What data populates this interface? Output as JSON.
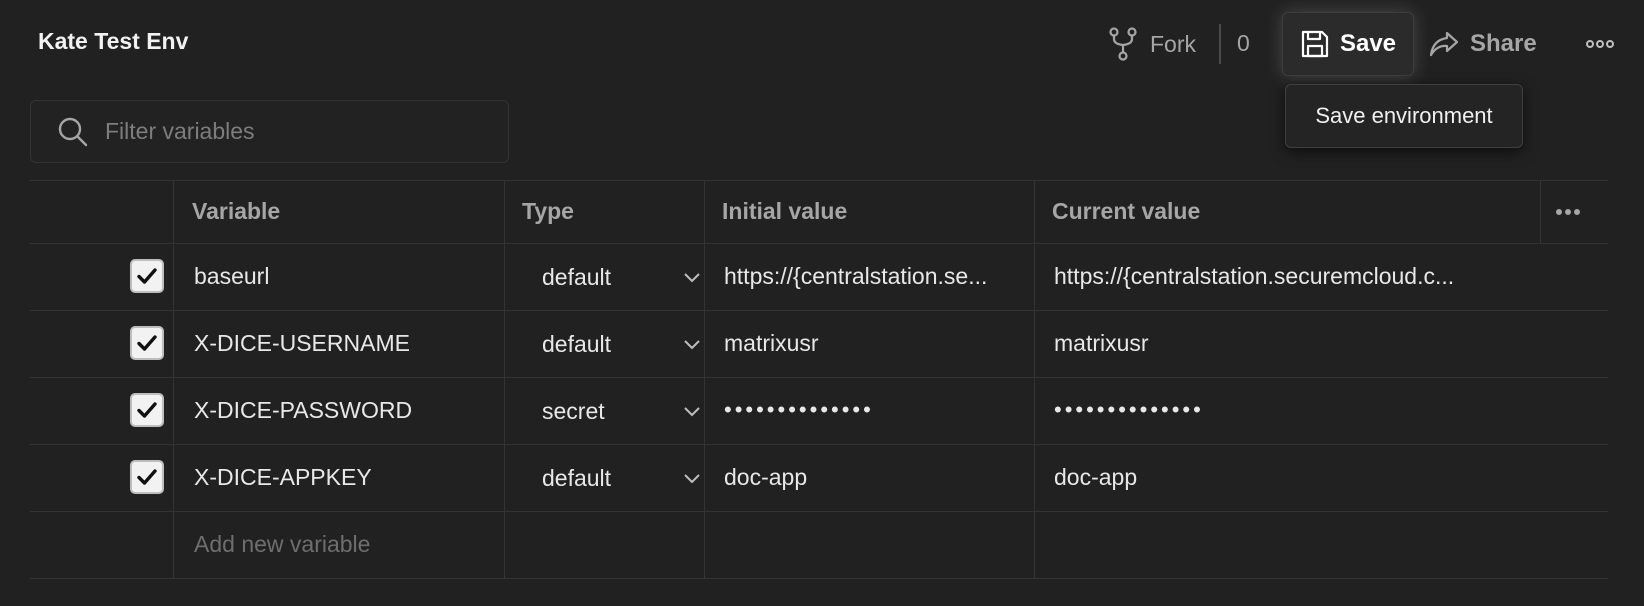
{
  "header": {
    "title": "Kate Test Env",
    "fork_label": "Fork",
    "fork_count": "0",
    "save_label": "Save",
    "share_label": "Share",
    "save_tooltip": "Save environment"
  },
  "filter": {
    "placeholder": "Filter variables",
    "value": ""
  },
  "table": {
    "columns": {
      "variable": "Variable",
      "type": "Type",
      "initial_value": "Initial value",
      "current_value": "Current value"
    },
    "rows": [
      {
        "checked": true,
        "name": "baseurl",
        "type": "default",
        "initial": "https://{centralstation.se...",
        "current": "https://{centralstation.securemcloud.c..."
      },
      {
        "checked": true,
        "name": "X-DICE-USERNAME",
        "type": "default",
        "initial": "matrixusr",
        "current": "matrixusr"
      },
      {
        "checked": true,
        "name": "X-DICE-PASSWORD",
        "type": "secret",
        "initial": "••••••••••••••",
        "current": "••••••••••••••"
      },
      {
        "checked": true,
        "name": "X-DICE-APPKEY",
        "type": "default",
        "initial": "doc-app",
        "current": "doc-app"
      }
    ],
    "add_placeholder": "Add new variable"
  },
  "icons": {
    "fork": "fork-icon",
    "save": "floppy-disk-icon",
    "share": "share-arrow-icon",
    "more": "more-horizontal-icon",
    "search": "search-icon",
    "check": "checkmark-icon",
    "chevron": "chevron-down-icon"
  },
  "colors": {
    "background": "#212121",
    "border": "#343434",
    "text": "#e8e8e8",
    "muted": "#a6a6a6"
  }
}
